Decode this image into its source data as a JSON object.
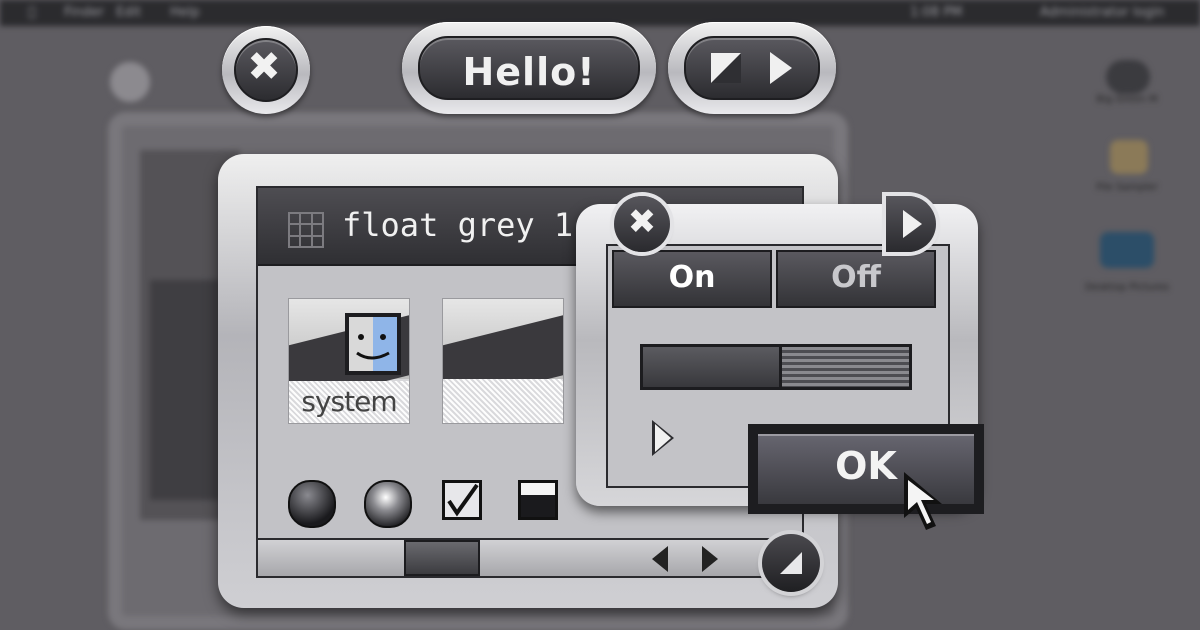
{
  "menubar": {
    "apple_icon": "apple-icon",
    "items": [
      "Finder",
      "Edit",
      "Help"
    ],
    "time": "1:08 PM",
    "user": "Administrator login"
  },
  "desktop_icons": [
    {
      "label": "Big Green M",
      "icon": "disk-icon"
    },
    {
      "label": "File Sampler",
      "icon": "application-icon"
    },
    {
      "label": "Desktop Pictures",
      "icon": "folder-icon"
    }
  ],
  "floating_controls": {
    "close_icon": "close-x-icon",
    "hello_label": "Hello!",
    "nav_icons": [
      "zoom-icon",
      "play-right-icon"
    ]
  },
  "main_window": {
    "title": "float grey 1.",
    "title_icon": "grid-icon",
    "thumbnails": [
      {
        "label": "system",
        "icon": "finder-face-icon"
      },
      {
        "label": "",
        "icon": "landscape-icon"
      }
    ],
    "controls": [
      "radio-ball-dark",
      "radio-ball-light",
      "checkbox-checked",
      "checkbox-mixed"
    ],
    "scroll_arrows": [
      "left-arrow-icon",
      "right-arrow-icon"
    ],
    "resize_icon": "resize-corner-icon"
  },
  "small_window": {
    "segments": [
      {
        "label": "On",
        "color": "#ffffff"
      },
      {
        "label": "Off",
        "color": "#c8c8cc"
      }
    ],
    "progress": 0.51,
    "disclosure_icon": "disclosure-triangle-icon",
    "ok_label": "OK"
  },
  "colors": {
    "background": "#5f5d62",
    "chrome_light": "#efefef",
    "chrome_dark": "#2c2c30"
  }
}
